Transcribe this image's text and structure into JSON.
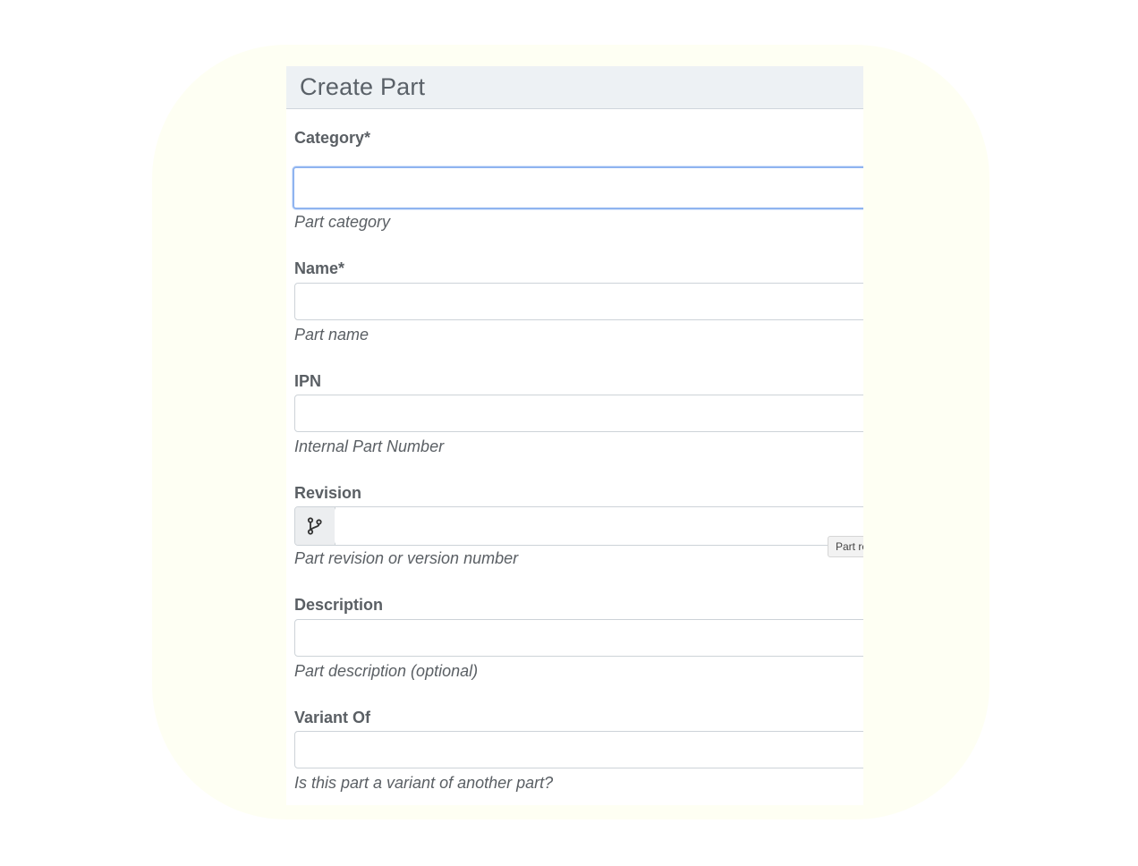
{
  "form": {
    "title": "Create Part",
    "fields": [
      {
        "label": "Category*",
        "value": "",
        "help": "Part category"
      },
      {
        "label": "Name*",
        "value": "",
        "help": "Part name"
      },
      {
        "label": "IPN",
        "value": "",
        "help": "Internal Part Number"
      },
      {
        "label": "Revision",
        "value": "",
        "help": "Part revision or version number",
        "icon": "code-branch-icon"
      },
      {
        "label": "Description",
        "value": "",
        "help": "Part description (optional)"
      },
      {
        "label": "Variant Of",
        "value": "",
        "help": "Is this part a variant of another part?"
      }
    ],
    "tooltip": "Part revision or version number"
  }
}
